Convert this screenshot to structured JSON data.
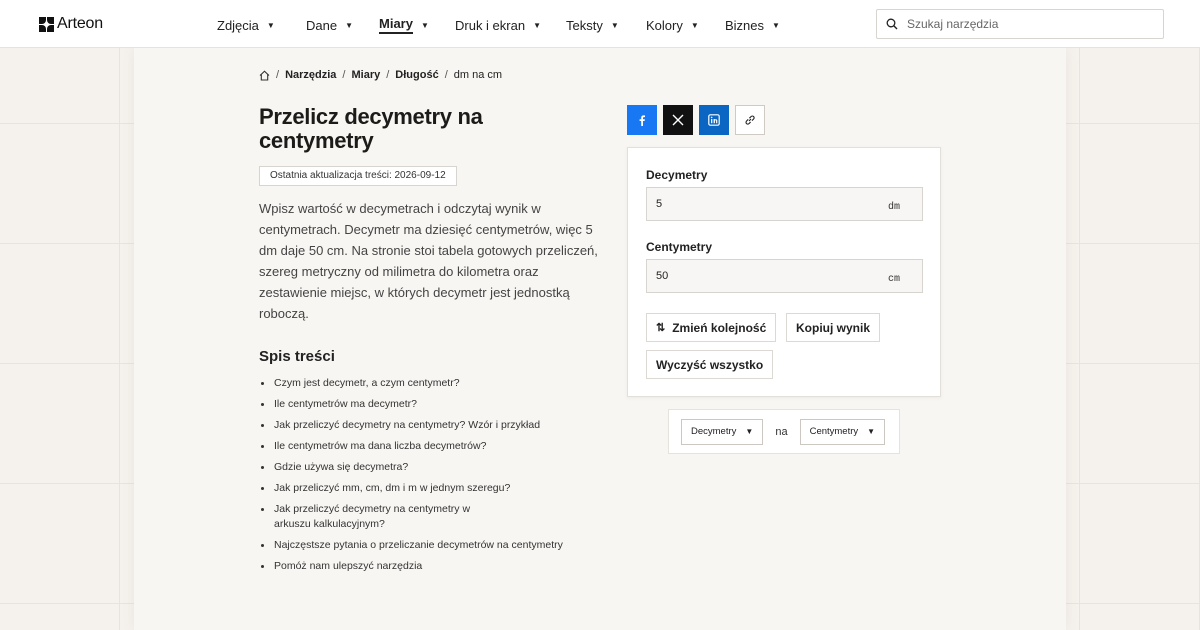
{
  "brand": {
    "name": "Arteon"
  },
  "nav": [
    {
      "label": "Zdjęcia",
      "active": false
    },
    {
      "label": "Dane",
      "active": false
    },
    {
      "label": "Miary",
      "active": true
    },
    {
      "label": "Druk i ekran",
      "active": false
    },
    {
      "label": "Teksty",
      "active": false
    },
    {
      "label": "Kolory",
      "active": false
    },
    {
      "label": "Biznes",
      "active": false
    }
  ],
  "search": {
    "placeholder": "Szukaj narzędzia",
    "value": ""
  },
  "breadcrumb": {
    "items": [
      "Narzędzia",
      "Miary",
      "Długość"
    ],
    "current": "dm na cm"
  },
  "page": {
    "title": "Przelicz decymetry na centymetry",
    "updated": "Ostatnia aktualizacja treści: 2026-09-12",
    "intro": "Wpisz wartość w decymetrach i odczytaj wynik w centymetrach. Decymetr ma dziesięć centymetrów, więc 5 dm daje 50 cm. Na stronie stoi tabela gotowych przeliczeń, szereg metryczny od milimetra do kilometra oraz zestawienie miejsc, w których decymetr jest jednostką roboczą."
  },
  "toc": {
    "title": "Spis treści",
    "items": [
      "Czym jest decymetr, a czym centymetr?",
      "Ile centymetrów ma decymetr?",
      "Jak przeliczyć decymetry na centymetry? Wzór i przykład",
      "Ile centymetrów ma dana liczba decymetrów?",
      "Gdzie używa się decymetra?",
      "Jak przeliczyć mm, cm, dm i m w jednym szeregu?",
      "Jak przeliczyć decymetry na centymetry w arkuszu kalkulacyjnym?",
      "Najczęstsze pytania o przeliczanie decymetrów na centymetry",
      "Pomóż nam ulepszyć narzędzia"
    ]
  },
  "share": {
    "icons": [
      "facebook-icon",
      "x-icon",
      "linkedin-icon",
      "link-icon"
    ],
    "colors": {
      "facebook": "#1877f2",
      "x": "#111111",
      "linkedin": "#0a66c2"
    }
  },
  "converter": {
    "from": {
      "label": "Decymetry",
      "value": "5",
      "unit": "dm"
    },
    "to": {
      "label": "Centymetry",
      "value": "50",
      "unit": "cm"
    },
    "buttons": {
      "swap": "Zmień kolejność",
      "copy": "Kopiuj wynik",
      "clear": "Wyczyść wszystko"
    }
  },
  "unit_selector": {
    "from": "Decymetry",
    "connector": "na",
    "to": "Centymetry"
  }
}
